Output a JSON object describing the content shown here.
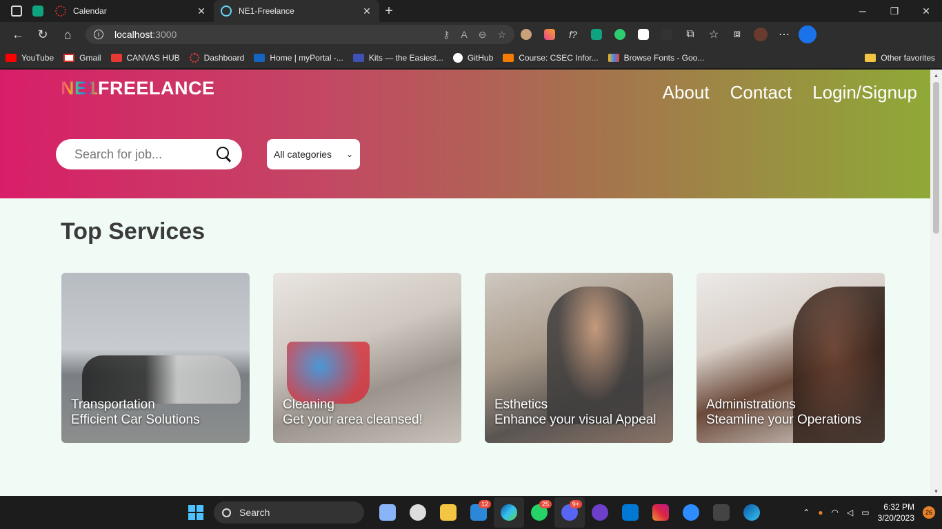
{
  "browser": {
    "tabs": [
      {
        "title": "Calendar",
        "close": "✕"
      },
      {
        "title": "NE1-Freelance",
        "close": "✕"
      }
    ],
    "new_tab": "+",
    "window_controls": [
      "─",
      "❐",
      "✕"
    ],
    "address": {
      "host": "localhost",
      "port": ":3000"
    },
    "bookmarks": [
      "YouTube",
      "Gmail",
      "CANVAS HUB",
      "Dashboard",
      "Home | myPortal -...",
      "Kits — the Easiest...",
      "GitHub",
      "Course: CSEC Infor...",
      "Browse Fonts - Goo..."
    ],
    "other_favorites": "Other favorites"
  },
  "site": {
    "logo_prefix": "NE1",
    "logo_suffix": "FREELANCE",
    "nav": [
      "About",
      "Contact",
      "Login/Signup"
    ],
    "search_placeholder": "Search for job...",
    "category_selected": "All categories",
    "section_title": "Top Services",
    "services": [
      {
        "title": "Transportation",
        "tagline": "Efficient Car Solutions"
      },
      {
        "title": "Cleaning",
        "tagline": "Get your area cleansed!"
      },
      {
        "title": "Esthetics",
        "tagline": "Enhance your visual Appeal"
      },
      {
        "title": "Administrations",
        "tagline": "Steamline your Operations"
      }
    ]
  },
  "taskbar": {
    "search_label": "Search",
    "badges": {
      "mail": "12",
      "whatsapp": "25",
      "discord": "9+"
    },
    "time": "6:32 PM",
    "date": "3/20/2023",
    "notifications": "26"
  }
}
